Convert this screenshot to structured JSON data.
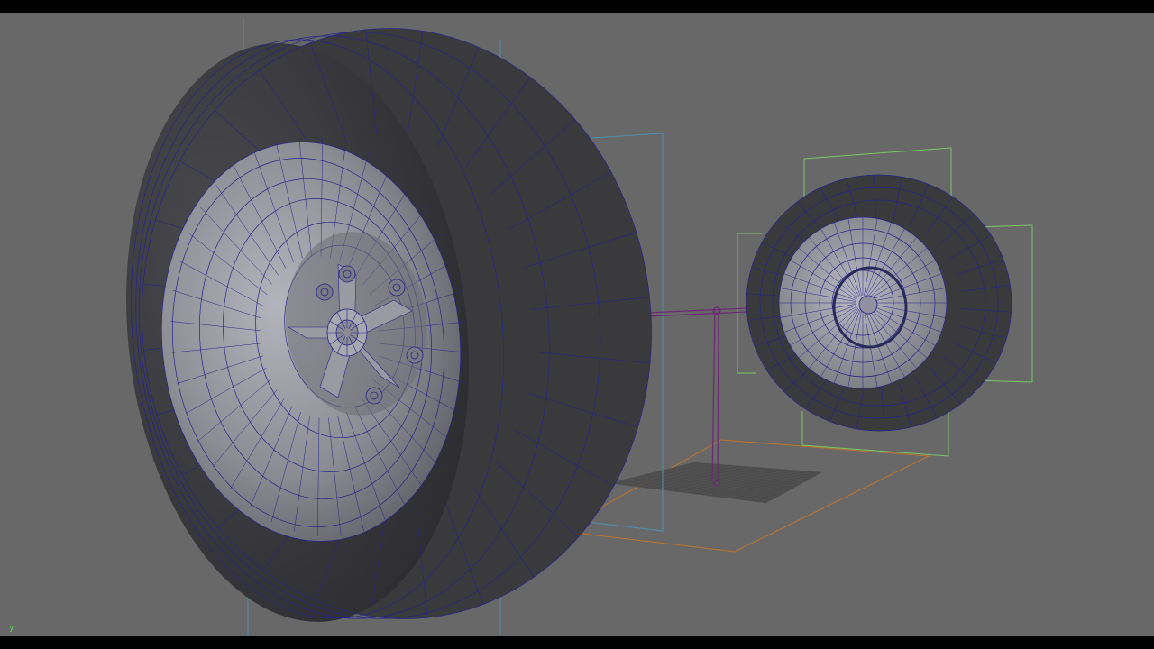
{
  "viewport": {
    "background": "#686868",
    "axis_indicator": "y"
  },
  "colors": {
    "tire": "#3a3a3d",
    "rim": "#8a8a92",
    "wire": "#26248a",
    "bbox_cyan": "#4f90b0",
    "bbox_green": "#7ac66a",
    "plane_orange": "#c0742a",
    "rig_purple": "#6a2a72"
  },
  "scene": {
    "objects": [
      "large-wheel",
      "small-wheel",
      "axle-rig",
      "ground-plane"
    ]
  }
}
